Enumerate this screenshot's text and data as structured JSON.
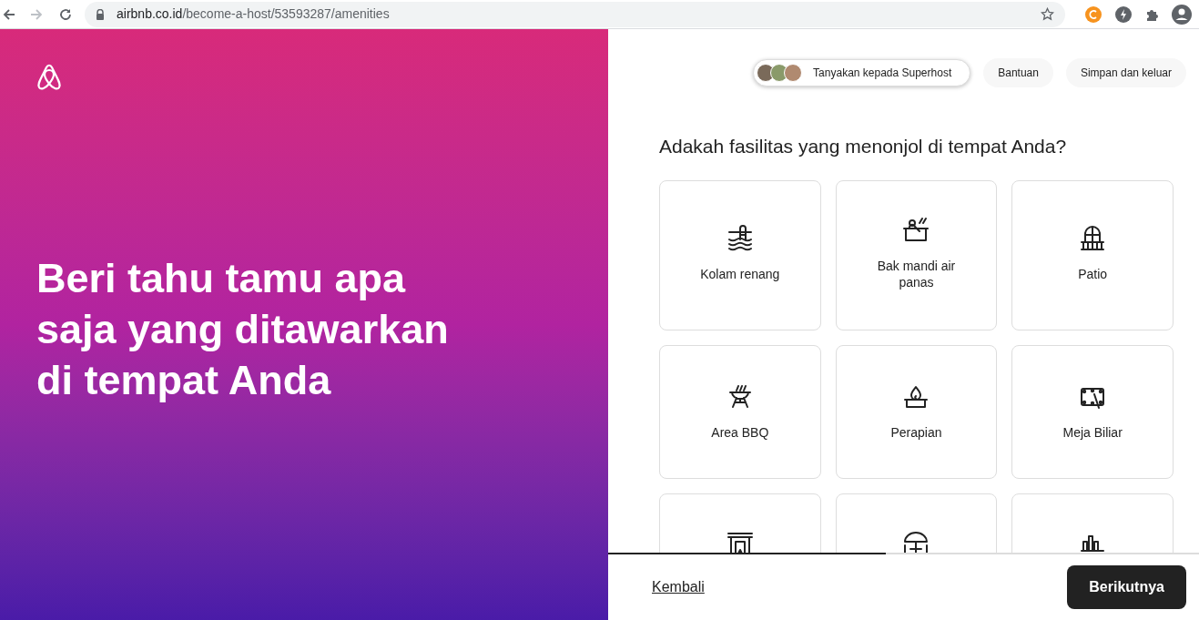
{
  "browser": {
    "url_host": "airbnb.co.id",
    "url_path": "/become-a-host/53593287/amenities",
    "forward_disabled": true
  },
  "left_panel": {
    "headline": "Beri tahu tamu apa saja yang ditawarkan di tempat Anda"
  },
  "header": {
    "superhost_button": "Tanyakan kepada Superhost",
    "help_button": "Bantuan",
    "save_exit_button": "Simpan dan keluar"
  },
  "question": "Adakah fasilitas yang menonjol di tempat Anda?",
  "amenities": [
    {
      "label": "Kolam renang",
      "selected": false
    },
    {
      "label": "Bak mandi air panas",
      "selected": false
    },
    {
      "label": "Patio",
      "selected": false
    },
    {
      "label": "Area BBQ",
      "selected": false
    },
    {
      "label": "Perapian",
      "selected": false
    },
    {
      "label": "Meja Biliar",
      "selected": false
    },
    {
      "selected": false
    },
    {
      "selected": false
    },
    {
      "selected": false
    }
  ],
  "progress": {
    "level": 0.47
  },
  "footer": {
    "back_link": "Kembali",
    "next_button": "Berikutnya"
  }
}
